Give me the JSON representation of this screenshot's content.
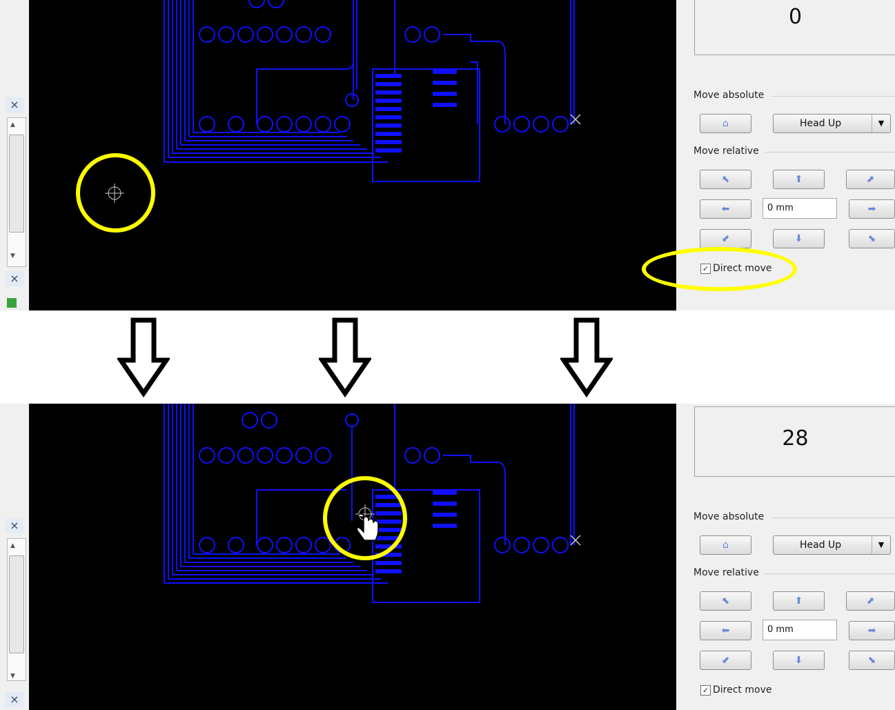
{
  "top": {
    "counter_value": "0",
    "move_absolute_label": "Move absolute",
    "head_up_label": "Head Up",
    "move_relative_label": "Move relative",
    "step_value": "0 mm",
    "direct_move_label": "Direct move",
    "direct_move_checked": true
  },
  "bottom": {
    "counter_value": "28",
    "move_absolute_label": "Move absolute",
    "head_up_label": "Head Up",
    "move_relative_label": "Move relative",
    "step_value": "0 mm",
    "direct_move_label": "Direct move",
    "direct_move_checked": true
  },
  "icons": {
    "close": "×",
    "dropdown": "▼",
    "home": "house-icon",
    "diag_up_left": "arrow-up-left-icon",
    "up": "arrow-up-icon",
    "diag_up_right": "arrow-up-right-icon",
    "left": "arrow-left-icon",
    "right": "arrow-right-icon",
    "diag_down_left": "arrow-down-left-icon",
    "down": "arrow-down-icon",
    "diag_down_right": "arrow-down-right-icon",
    "crosshair": "crosshair-icon",
    "hand_cursor": "hand-cursor-icon"
  },
  "colors": {
    "pcb_trace": "#1010ff",
    "canvas_bg": "#000000",
    "highlight": "#ffff00",
    "panel_bg": "#f0f0f0"
  }
}
